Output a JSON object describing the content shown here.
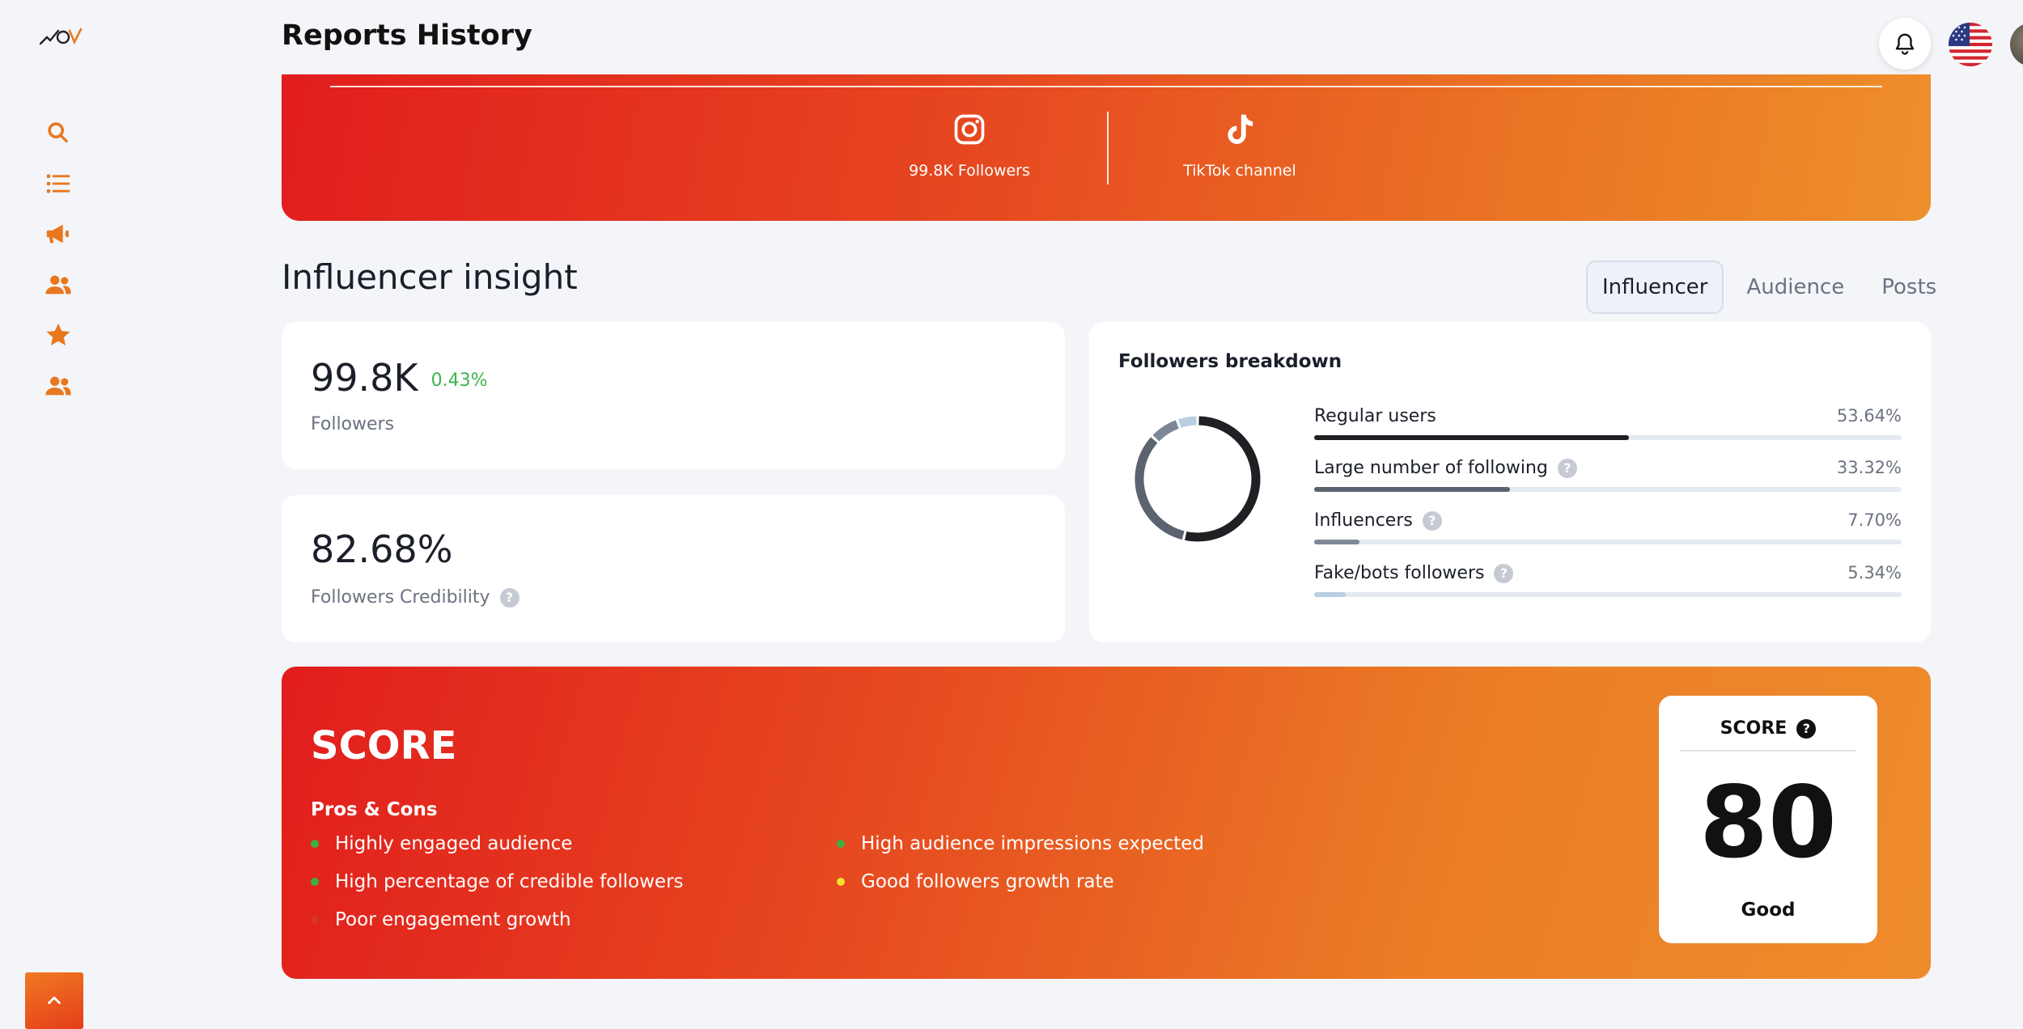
{
  "header": {
    "title": "Reports History"
  },
  "banner": {
    "instagram_label": "99.8K Followers",
    "tiktok_label": "TikTok channel"
  },
  "insight": {
    "title": "Influencer insight",
    "tabs": [
      "Influencer",
      "Audience",
      "Posts"
    ],
    "active_tab": "Influencer"
  },
  "followers_card": {
    "value": "99.8K",
    "change": "0.43%",
    "label": "Followers"
  },
  "credibility_card": {
    "value": "82.68%",
    "label": "Followers Credibility"
  },
  "breakdown": {
    "title": "Followers breakdown",
    "items": [
      {
        "label": "Regular users",
        "value": "53.64%",
        "percent": 53.64,
        "color": "#1f2023",
        "help": false
      },
      {
        "label": "Large number of following",
        "value": "33.32%",
        "percent": 33.32,
        "color": "#5b6370",
        "help": true
      },
      {
        "label": "Influencers",
        "value": "7.70%",
        "percent": 7.7,
        "color": "#7d8797",
        "help": true
      },
      {
        "label": "Fake/bots followers",
        "value": "5.34%",
        "percent": 5.34,
        "color": "#b9cde3",
        "help": true
      }
    ]
  },
  "score": {
    "title": "SCORE",
    "pros_cons_title": "Pros & Cons",
    "items": [
      {
        "text": "Highly engaged audience",
        "color": "#3cb043"
      },
      {
        "text": "High percentage of credible followers",
        "color": "#3cb043"
      },
      {
        "text": "Poor engagement growth",
        "color": "#d9342a"
      },
      {
        "text": "High audience impressions expected",
        "color": "#3cb043"
      },
      {
        "text": "Good followers growth rate",
        "color": "#f5e02a"
      }
    ],
    "box_title": "SCORE",
    "value": "80",
    "rating": "Good"
  },
  "colors": {
    "accent": "#e8771e",
    "gradient_start": "#e11d1d",
    "gradient_end": "#ee8c2c",
    "positive": "#3bb54a"
  }
}
